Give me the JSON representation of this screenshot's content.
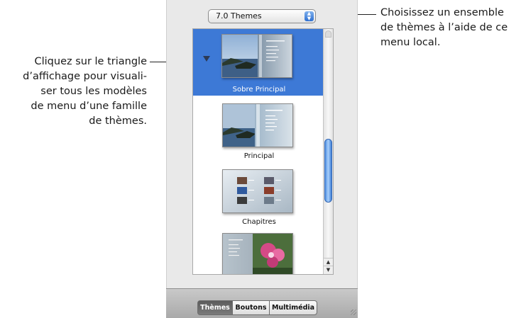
{
  "callouts": {
    "left": [
      "Cliquez sur le triangle",
      "d’affichage pour visuali-",
      "ser tous les modèles",
      "de menu d’une famille",
      "de thèmes."
    ],
    "right": [
      "Choisissez un ensemble",
      "de thèmes à l’aide de ce",
      "menu local."
    ]
  },
  "theme_popup": {
    "selected": "7.0 Themes"
  },
  "themes": [
    {
      "name": "Sobre Principal",
      "selected": true
    },
    {
      "name": "Principal",
      "selected": false
    },
    {
      "name": "Chapitres",
      "selected": false
    }
  ],
  "tabs": [
    {
      "label": "Thèmes",
      "active": true
    },
    {
      "label": "Boutons",
      "active": false
    },
    {
      "label": "Multimédia",
      "active": false
    }
  ],
  "colors": {
    "selection": "#3d79d6",
    "panel": "#e9e9e9",
    "scroll_thumb": "#4f8fe0"
  },
  "icons": {
    "popup": "up-down-arrows-icon",
    "disclosure": "disclosure-triangle-icon",
    "scroll_up": "arrow-up-icon",
    "scroll_down": "arrow-down-icon"
  }
}
